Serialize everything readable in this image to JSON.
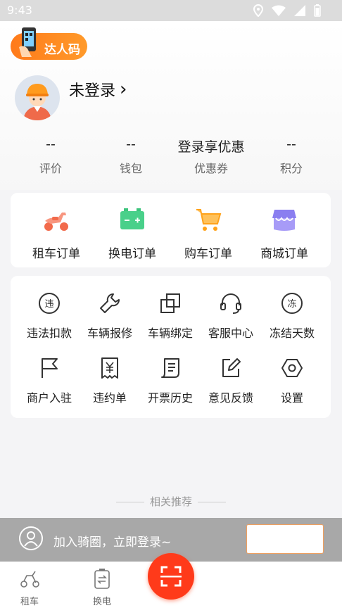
{
  "status": {
    "time": "9:43"
  },
  "header": {
    "daren_label": "达人码",
    "login_text": "未登录",
    "login_arrow": "›"
  },
  "stats": [
    {
      "value": "--",
      "label": "评价"
    },
    {
      "value": "--",
      "label": "钱包"
    },
    {
      "value": "登录享优惠",
      "label": "优惠券"
    },
    {
      "value": "--",
      "label": "积分"
    }
  ],
  "orders": [
    {
      "label": "租车订单",
      "icon": "scooter-icon",
      "color": "#f26a4b"
    },
    {
      "label": "换电订单",
      "icon": "battery-icon",
      "color": "#3cc47c"
    },
    {
      "label": "购车订单",
      "icon": "cart-icon",
      "color": "#ffa21a"
    },
    {
      "label": "商城订单",
      "icon": "shop-icon",
      "color": "#8a7ef0"
    }
  ],
  "tools": [
    {
      "label": "违法扣款",
      "icon": "violation-icon",
      "glyph": "违"
    },
    {
      "label": "车辆报修",
      "icon": "wrench-icon"
    },
    {
      "label": "车辆绑定",
      "icon": "bind-icon"
    },
    {
      "label": "客服中心",
      "icon": "headset-icon"
    },
    {
      "label": "冻结天数",
      "icon": "freeze-icon",
      "glyph": "冻"
    },
    {
      "label": "商户入驻",
      "icon": "flag-icon"
    },
    {
      "label": "违约单",
      "icon": "receipt-icon"
    },
    {
      "label": "开票历史",
      "icon": "invoice-icon"
    },
    {
      "label": "意见反馈",
      "icon": "edit-icon"
    },
    {
      "label": "设置",
      "icon": "settings-icon"
    }
  ],
  "recommend": {
    "title": "相关推荐"
  },
  "banner": {
    "text": "加入骑圈，立即登录~"
  },
  "tabs": [
    {
      "label": "租车",
      "icon": "scooter-tab-icon"
    },
    {
      "label": "换电",
      "icon": "battery-tab-icon"
    }
  ],
  "theme": {
    "accent": "#ff5a1a"
  }
}
